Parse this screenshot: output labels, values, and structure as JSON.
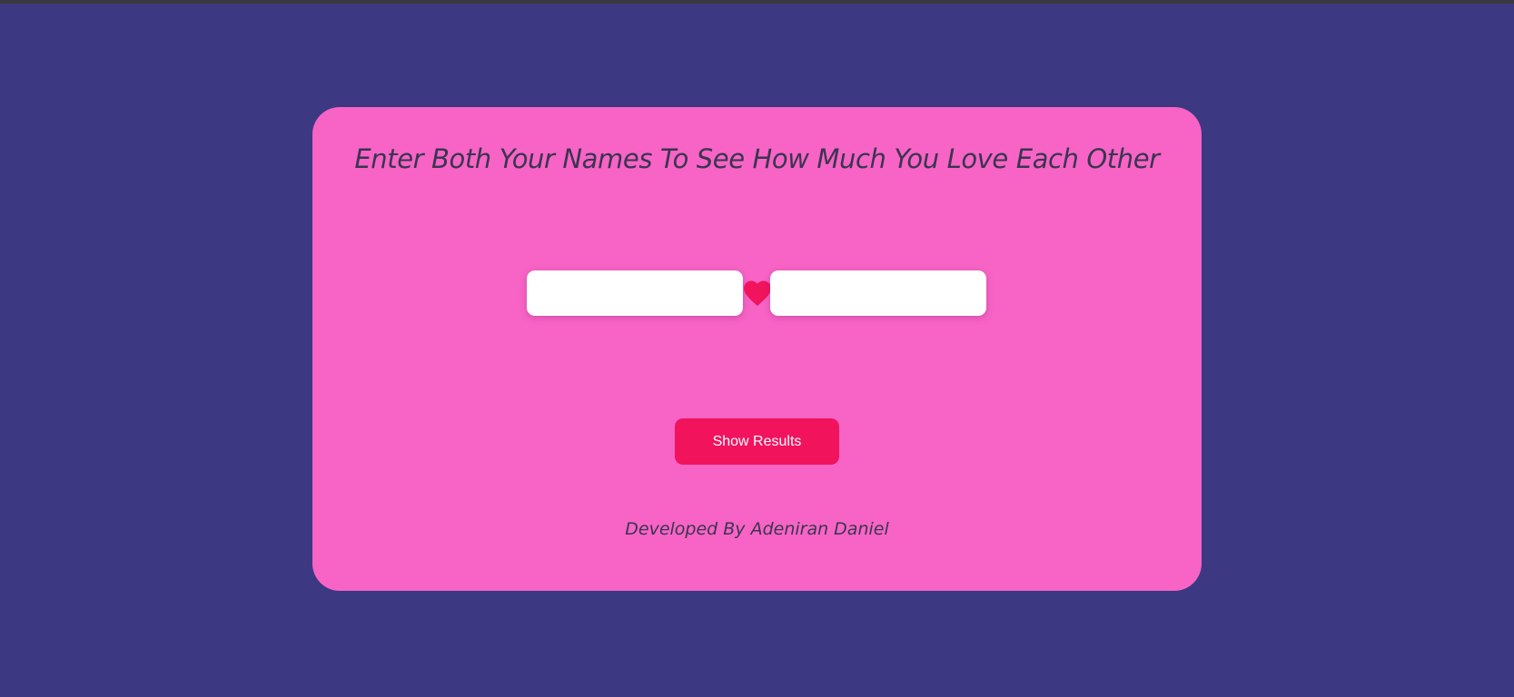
{
  "page": {
    "title": "Enter Both Your Names To See How Much You Love Each Other",
    "credit": "Developed By Adeniran Daniel"
  },
  "form": {
    "first_name": {
      "value": "",
      "placeholder": ""
    },
    "second_name": {
      "value": "",
      "placeholder": ""
    },
    "separator_icon": "heart-icon",
    "submit_label": "Show Results"
  },
  "colors": {
    "background": "#3d3882",
    "card": "#f764c6",
    "accent": "#f2135d",
    "text": "#3a3550"
  }
}
